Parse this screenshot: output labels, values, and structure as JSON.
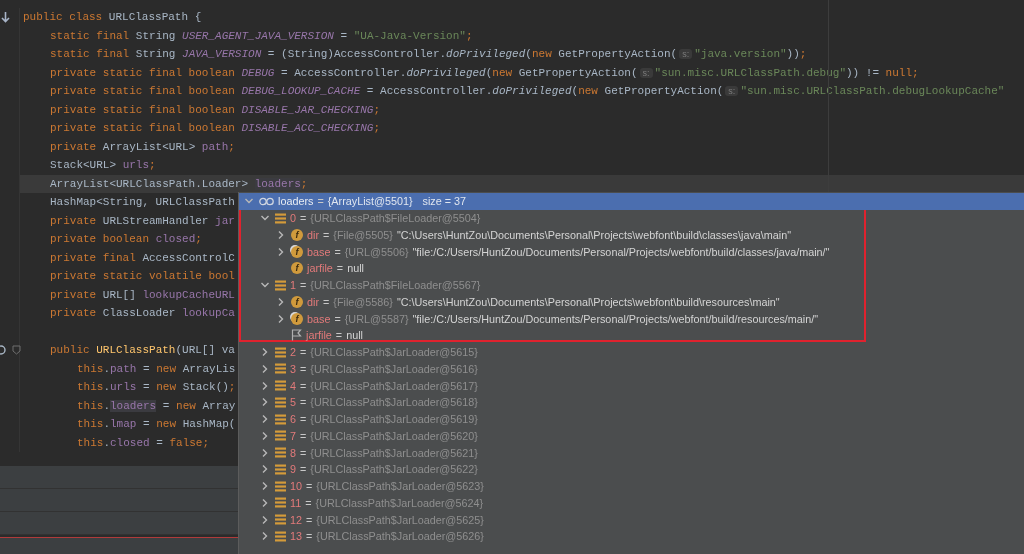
{
  "code_lines": [
    {
      "kind": "top",
      "current": false,
      "tokens": [
        {
          "kind": "kw",
          "text": "public class "
        },
        {
          "kind": "plain",
          "text": "URLClassPath {"
        }
      ]
    },
    {
      "kind": "member",
      "current": false,
      "tokens": [
        {
          "kind": "kw",
          "text": "static final "
        },
        {
          "kind": "plain",
          "text": "String "
        },
        {
          "kind": "const",
          "text": "USER_AGENT_JAVA_VERSION"
        },
        {
          "kind": "plain",
          "text": " = "
        },
        {
          "kind": "str",
          "text": "\"UA-Java-Version\""
        },
        {
          "kind": "kw",
          "text": ";"
        }
      ]
    },
    {
      "kind": "member",
      "current": false,
      "tokens": [
        {
          "kind": "kw",
          "text": "static final "
        },
        {
          "kind": "plain",
          "text": "String "
        },
        {
          "kind": "const",
          "text": "JAVA_VERSION"
        },
        {
          "kind": "plain",
          "text": " = (String)AccessController."
        },
        {
          "kind": "method",
          "text": "doPrivileged"
        },
        {
          "kind": "plain",
          "text": "("
        },
        {
          "kind": "kw",
          "text": "new "
        },
        {
          "kind": "plain",
          "text": "GetPropertyAction("
        },
        {
          "kind": "hint",
          "text": "s:"
        },
        {
          "kind": "str",
          "text": "\"java.version\""
        },
        {
          "kind": "plain",
          "text": "))"
        },
        {
          "kind": "kw",
          "text": ";"
        }
      ]
    },
    {
      "kind": "member",
      "current": false,
      "tokens": [
        {
          "kind": "kw",
          "text": "private static final boolean "
        },
        {
          "kind": "const",
          "text": "DEBUG"
        },
        {
          "kind": "plain",
          "text": " = AccessController."
        },
        {
          "kind": "method",
          "text": "doPrivileged"
        },
        {
          "kind": "plain",
          "text": "("
        },
        {
          "kind": "kw",
          "text": "new "
        },
        {
          "kind": "plain",
          "text": "GetPropertyAction("
        },
        {
          "kind": "hint",
          "text": "s:"
        },
        {
          "kind": "str",
          "text": "\"sun.misc.URLClassPath.debug\""
        },
        {
          "kind": "plain",
          "text": ")) != "
        },
        {
          "kind": "kw",
          "text": "null;"
        }
      ]
    },
    {
      "kind": "member",
      "current": false,
      "tokens": [
        {
          "kind": "kw",
          "text": "private static final boolean "
        },
        {
          "kind": "const",
          "text": "DEBUG_LOOKUP_CACHE"
        },
        {
          "kind": "plain",
          "text": " = AccessController."
        },
        {
          "kind": "method",
          "text": "doPrivileged"
        },
        {
          "kind": "plain",
          "text": "("
        },
        {
          "kind": "kw",
          "text": "new "
        },
        {
          "kind": "plain",
          "text": "GetPropertyAction("
        },
        {
          "kind": "hint",
          "text": "s:"
        },
        {
          "kind": "str",
          "text": "\"sun.misc.URLClassPath.debugLookupCache\""
        }
      ]
    },
    {
      "kind": "member",
      "current": false,
      "tokens": [
        {
          "kind": "kw",
          "text": "private static final boolean "
        },
        {
          "kind": "const",
          "text": "DISABLE_JAR_CHECKING"
        },
        {
          "kind": "kw",
          "text": ";"
        }
      ]
    },
    {
      "kind": "member",
      "current": false,
      "tokens": [
        {
          "kind": "kw",
          "text": "private static final boolean "
        },
        {
          "kind": "const",
          "text": "DISABLE_ACC_CHECKING"
        },
        {
          "kind": "kw",
          "text": ";"
        }
      ]
    },
    {
      "kind": "member",
      "current": false,
      "tokens": [
        {
          "kind": "kw",
          "text": "private "
        },
        {
          "kind": "plain",
          "text": "ArrayList<URL> "
        },
        {
          "kind": "field",
          "text": "path"
        },
        {
          "kind": "kw",
          "text": ";"
        }
      ]
    },
    {
      "kind": "member",
      "current": false,
      "tokens": [
        {
          "kind": "plain",
          "text": "Stack<URL> "
        },
        {
          "kind": "field",
          "text": "urls"
        },
        {
          "kind": "kw",
          "text": ";"
        }
      ]
    },
    {
      "kind": "member",
      "current": true,
      "tokens": [
        {
          "kind": "plain",
          "text": "ArrayList<URLClassPath.Loader> "
        },
        {
          "kind": "match",
          "text": "loaders"
        },
        {
          "kind": "kw",
          "text": ";"
        }
      ]
    },
    {
      "kind": "member",
      "current": false,
      "tokens": [
        {
          "kind": "plain",
          "text": "HashMap<String, URLClassPath"
        }
      ]
    },
    {
      "kind": "member",
      "current": false,
      "tokens": [
        {
          "kind": "kw",
          "text": "private "
        },
        {
          "kind": "plain",
          "text": "URLStreamHandler "
        },
        {
          "kind": "field",
          "text": "jar"
        }
      ]
    },
    {
      "kind": "member",
      "current": false,
      "tokens": [
        {
          "kind": "kw",
          "text": "private boolean "
        },
        {
          "kind": "field",
          "text": "closed"
        },
        {
          "kind": "kw",
          "text": ";"
        }
      ]
    },
    {
      "kind": "member",
      "current": false,
      "tokens": [
        {
          "kind": "kw",
          "text": "private final "
        },
        {
          "kind": "plain",
          "text": "AccessControlC"
        }
      ]
    },
    {
      "kind": "member",
      "current": false,
      "tokens": [
        {
          "kind": "kw",
          "text": "private static volatile bool"
        }
      ]
    },
    {
      "kind": "member",
      "current": false,
      "tokens": [
        {
          "kind": "kw",
          "text": "private "
        },
        {
          "kind": "plain",
          "text": "URL[] "
        },
        {
          "kind": "field",
          "text": "lookupCacheURL"
        }
      ]
    },
    {
      "kind": "member",
      "current": false,
      "tokens": [
        {
          "kind": "kw",
          "text": "private "
        },
        {
          "kind": "plain",
          "text": "ClassLoader "
        },
        {
          "kind": "field",
          "text": "lookupCa"
        }
      ]
    },
    {
      "kind": "blank",
      "current": false
    },
    {
      "kind": "member",
      "current": false,
      "tokens": [
        {
          "kind": "kw",
          "text": "public "
        },
        {
          "kind": "decl",
          "text": "URLClassPath"
        },
        {
          "kind": "plain",
          "text": "(URL[] va"
        }
      ]
    },
    {
      "kind": "body",
      "current": false,
      "tokens": [
        {
          "kind": "kw",
          "text": "this"
        },
        {
          "kind": "plain",
          "text": "."
        },
        {
          "kind": "field",
          "text": "path"
        },
        {
          "kind": "plain",
          "text": " = "
        },
        {
          "kind": "kw",
          "text": "new "
        },
        {
          "kind": "plain",
          "text": "ArrayLis"
        }
      ]
    },
    {
      "kind": "body",
      "current": false,
      "tokens": [
        {
          "kind": "kw",
          "text": "this"
        },
        {
          "kind": "plain",
          "text": "."
        },
        {
          "kind": "field",
          "text": "urls"
        },
        {
          "kind": "plain",
          "text": " = "
        },
        {
          "kind": "kw",
          "text": "new "
        },
        {
          "kind": "plain",
          "text": "Stack()"
        },
        {
          "kind": "kw",
          "text": ";"
        }
      ]
    },
    {
      "kind": "body",
      "current": false,
      "tokens": [
        {
          "kind": "kw",
          "text": "this"
        },
        {
          "kind": "plain",
          "text": "."
        },
        {
          "kind": "match",
          "text": "loaders"
        },
        {
          "kind": "plain",
          "text": " = "
        },
        {
          "kind": "kw",
          "text": "new "
        },
        {
          "kind": "plain",
          "text": "Array"
        }
      ]
    },
    {
      "kind": "body",
      "current": false,
      "tokens": [
        {
          "kind": "kw",
          "text": "this"
        },
        {
          "kind": "plain",
          "text": "."
        },
        {
          "kind": "field",
          "text": "lmap"
        },
        {
          "kind": "plain",
          "text": " = "
        },
        {
          "kind": "kw",
          "text": "new "
        },
        {
          "kind": "plain",
          "text": "HashMap("
        }
      ]
    },
    {
      "kind": "body",
      "current": false,
      "tokens": [
        {
          "kind": "kw",
          "text": "this"
        },
        {
          "kind": "plain",
          "text": "."
        },
        {
          "kind": "field",
          "text": "closed"
        },
        {
          "kind": "plain",
          "text": " = "
        },
        {
          "kind": "kw",
          "text": "false;"
        }
      ]
    }
  ],
  "debugger_popup": {
    "root": {
      "kind": "watch",
      "name": "loaders",
      "operator": "=",
      "type": "{ArrayList@5501}",
      "extra": "size = 37",
      "expanded": true,
      "selected": true,
      "children": [
        {
          "kind": "element",
          "name": "0",
          "operator": "=",
          "type": "{URLClassPath$FileLoader@5504}",
          "expanded": true,
          "selected": false,
          "children": [
            {
              "kind": "field",
              "badge": "f",
              "name": "dir",
              "operator": "=",
              "type": "{File@5505}",
              "value": "\"C:\\Users\\HuntZou\\Documents\\Personal\\Projects\\webfont\\build\\classes\\java\\main\"",
              "expanded": false,
              "selected": false
            },
            {
              "kind": "field-pinned",
              "badge": "f",
              "name": "base",
              "operator": "=",
              "type": "{URL@5506}",
              "value": "\"file:/C:/Users/HuntZou/Documents/Personal/Projects/webfont/build/classes/java/main/\"",
              "expanded": false,
              "selected": false
            },
            {
              "kind": "field",
              "badge": "f",
              "name": "jarfile",
              "operator": "=",
              "value": "null",
              "selected": false
            }
          ]
        },
        {
          "kind": "element",
          "name": "1",
          "operator": "=",
          "type": "{URLClassPath$FileLoader@5567}",
          "expanded": true,
          "selected": false,
          "children": [
            {
              "kind": "field",
              "badge": "f",
              "name": "dir",
              "operator": "=",
              "type": "{File@5586}",
              "value": "\"C:\\Users\\HuntZou\\Documents\\Personal\\Projects\\webfont\\build\\resources\\main\"",
              "expanded": false,
              "selected": false
            },
            {
              "kind": "field-pinned",
              "badge": "f",
              "name": "base",
              "operator": "=",
              "type": "{URL@5587}",
              "value": "\"file:/C:/Users/HuntZou/Documents/Personal/Projects/webfont/build/resources/main/\"",
              "expanded": false,
              "selected": false
            },
            {
              "kind": "flag",
              "name": "jarfile",
              "operator": "=",
              "value": "null",
              "selected": false
            }
          ]
        },
        {
          "kind": "element",
          "name": "2",
          "operator": "=",
          "type": "{URLClassPath$JarLoader@5615}",
          "expanded": false,
          "selected": false
        },
        {
          "kind": "element",
          "name": "3",
          "operator": "=",
          "type": "{URLClassPath$JarLoader@5616}",
          "expanded": false,
          "selected": false
        },
        {
          "kind": "element",
          "name": "4",
          "operator": "=",
          "type": "{URLClassPath$JarLoader@5617}",
          "expanded": false,
          "selected": false
        },
        {
          "kind": "element",
          "name": "5",
          "operator": "=",
          "type": "{URLClassPath$JarLoader@5618}",
          "expanded": false,
          "selected": false
        },
        {
          "kind": "element",
          "name": "6",
          "operator": "=",
          "type": "{URLClassPath$JarLoader@5619}",
          "expanded": false,
          "selected": false
        },
        {
          "kind": "element",
          "name": "7",
          "operator": "=",
          "type": "{URLClassPath$JarLoader@5620}",
          "expanded": false,
          "selected": false
        },
        {
          "kind": "element",
          "name": "8",
          "operator": "=",
          "type": "{URLClassPath$JarLoader@5621}",
          "expanded": false,
          "selected": false
        },
        {
          "kind": "element",
          "name": "9",
          "operator": "=",
          "type": "{URLClassPath$JarLoader@5622}",
          "expanded": false,
          "selected": false
        },
        {
          "kind": "element",
          "name": "10",
          "operator": "=",
          "type": "{URLClassPath$JarLoader@5623}",
          "expanded": false,
          "selected": false
        },
        {
          "kind": "element",
          "name": "11",
          "operator": "=",
          "type": "{URLClassPath$JarLoader@5624}",
          "expanded": false,
          "selected": false
        },
        {
          "kind": "element",
          "name": "12",
          "operator": "=",
          "type": "{URLClassPath$JarLoader@5625}",
          "expanded": false,
          "selected": false
        },
        {
          "kind": "element",
          "name": "13",
          "operator": "=",
          "type": "{URLClassPath$JarLoader@5626}",
          "expanded": false,
          "selected": false
        }
      ]
    }
  }
}
